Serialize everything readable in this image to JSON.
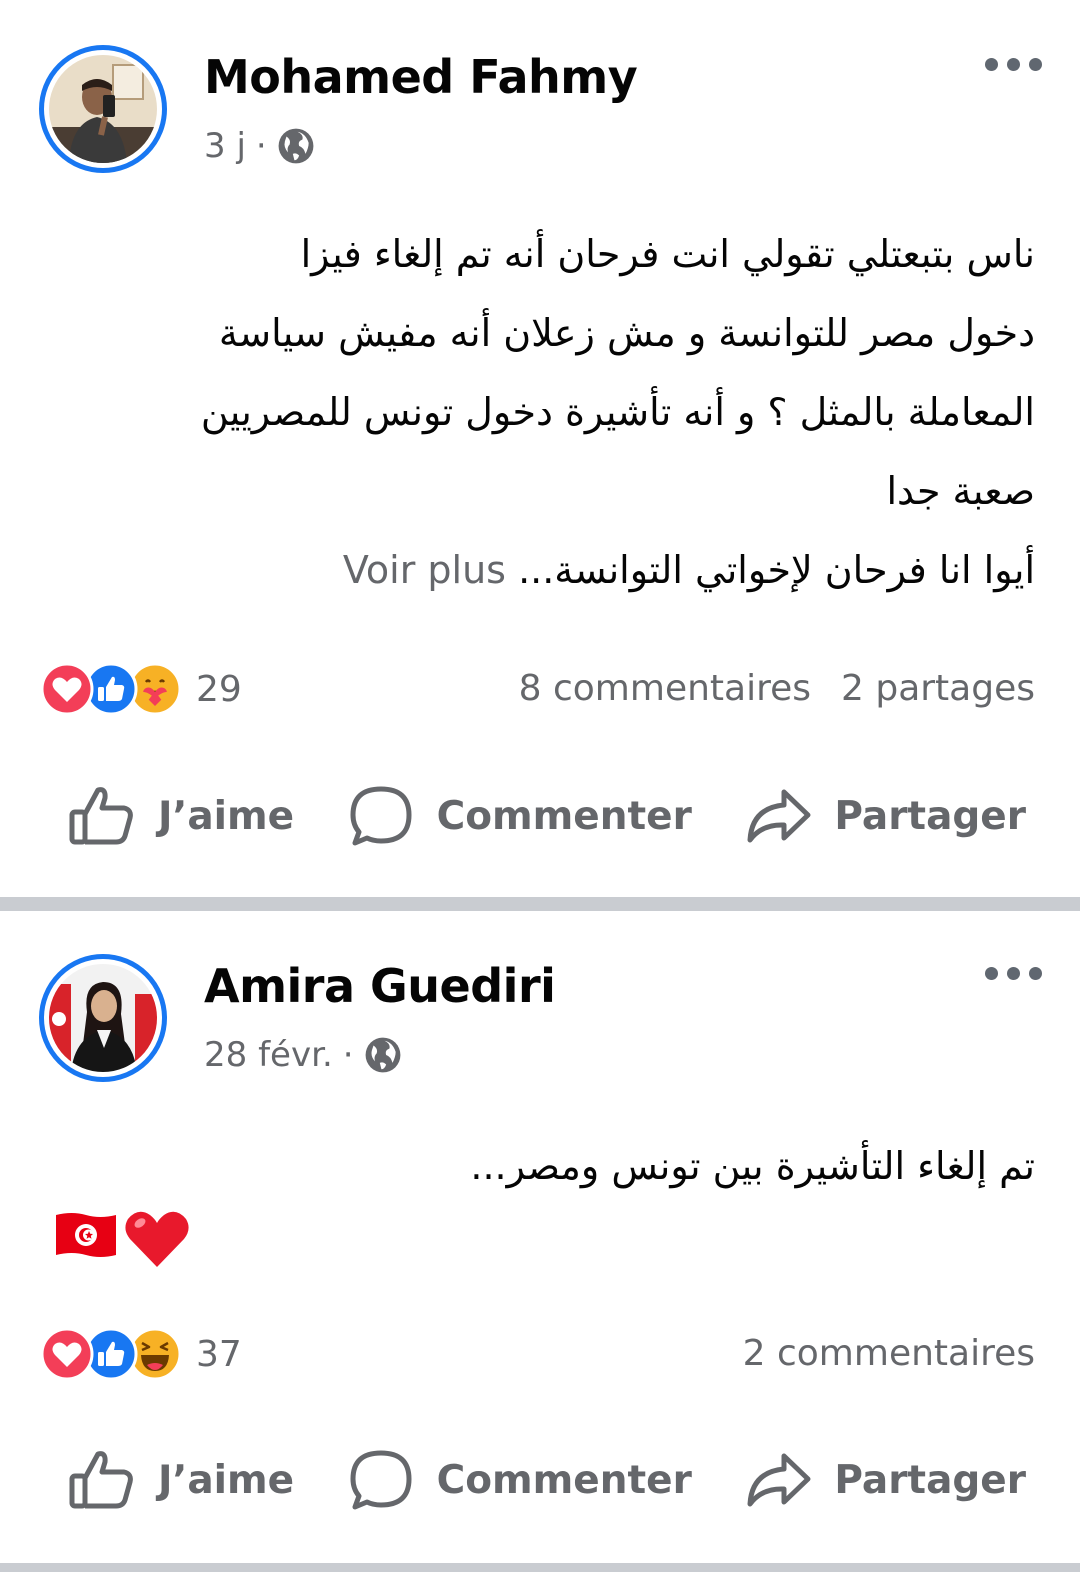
{
  "posts": [
    {
      "author": "Mohamed Fahmy",
      "time": "3 j",
      "separator": "·",
      "text_lines": [
        "ناس بتبعتلي تقولي انت فرحان أنه تم إلغاء فيزا",
        "دخول مصر للتوانسة و مش زعلان أنه مفيش سياسة",
        "المعاملة بالمثل ؟ و أنه تأشيرة دخول تونس للمصريين",
        "صعبة جدا"
      ],
      "last_line": "أيوا انا فرحان لإخواتي التوانسة...",
      "see_more": "Voir plus",
      "reaction_icons": [
        "heart-reaction-icon",
        "like-reaction-icon",
        "care-reaction-icon"
      ],
      "reaction_count": "29",
      "comments": "8 commentaires",
      "shares": "2 partages"
    },
    {
      "author": "Amira Guediri",
      "time": "28 févr.",
      "separator": "·",
      "text_lines": [
        "تم إلغاء التأشيرة بين تونس ومصر..."
      ],
      "emoji_icons": [
        "tunisia-flag-icon",
        "red-heart-icon"
      ],
      "reaction_icons": [
        "heart-reaction-icon",
        "like-reaction-icon",
        "haha-reaction-icon"
      ],
      "reaction_count": "37",
      "comments": "2 commentaires"
    }
  ],
  "actions": {
    "like": "J’aime",
    "comment": "Commenter",
    "share": "Partager"
  },
  "colors": {
    "accent": "#1877f2",
    "secondary_text": "#65676b",
    "divider": "#c9ccd1",
    "love_red": "#f33e58",
    "care_yellow": "#f7b125"
  },
  "icons": [
    "globe-icon",
    "more-options-icon",
    "like-outline-icon",
    "comment-bubble-icon",
    "share-arrow-icon"
  ]
}
